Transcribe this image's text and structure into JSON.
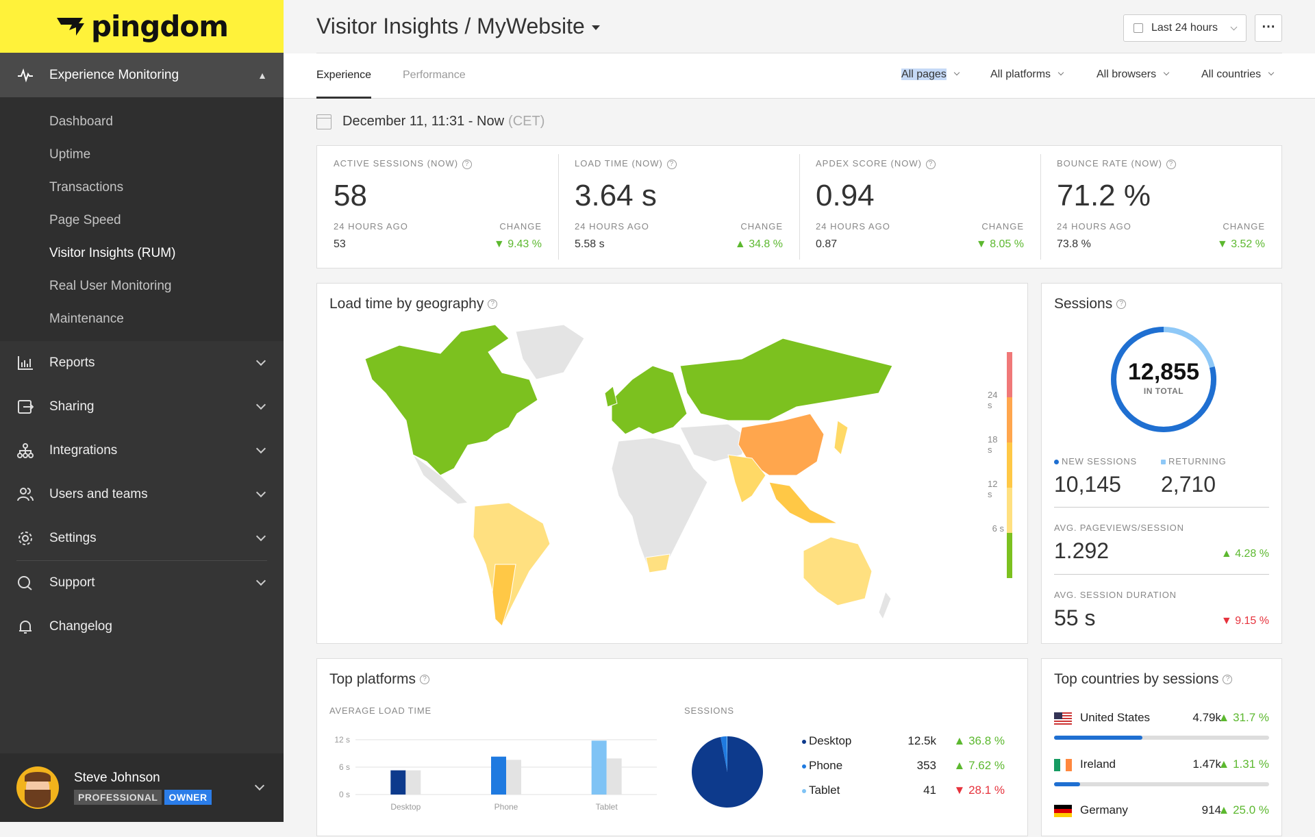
{
  "brand": {
    "name": "pingdom",
    "color": "#fff23a"
  },
  "sidebar": {
    "section": {
      "label": "Experience Monitoring"
    },
    "subitems": [
      {
        "label": "Dashboard"
      },
      {
        "label": "Uptime"
      },
      {
        "label": "Transactions"
      },
      {
        "label": "Page Speed"
      },
      {
        "label": "Visitor Insights (RUM)",
        "active": true
      },
      {
        "label": "Real User Monitoring"
      },
      {
        "label": "Maintenance"
      }
    ],
    "items": [
      {
        "label": "Reports",
        "icon": "chart-icon"
      },
      {
        "label": "Sharing",
        "icon": "share-icon"
      },
      {
        "label": "Integrations",
        "icon": "network-icon"
      },
      {
        "label": "Users and teams",
        "icon": "users-icon"
      },
      {
        "label": "Settings",
        "icon": "gear-icon"
      },
      {
        "label": "Support",
        "icon": "chat-icon"
      },
      {
        "label": "Changelog",
        "icon": "bell-icon"
      }
    ],
    "user": {
      "name": "Steve Johnson",
      "plan": "PROFESSIONAL",
      "role": "OWNER"
    }
  },
  "header": {
    "title": "Visitor Insights / MyWebsite",
    "time_range": "Last 24 hours",
    "more": "⋯"
  },
  "tabs": [
    {
      "label": "Experience",
      "active": true
    },
    {
      "label": "Performance"
    }
  ],
  "filters": [
    {
      "label": "All pages",
      "selected": true
    },
    {
      "label": "All platforms"
    },
    {
      "label": "All browsers"
    },
    {
      "label": "All countries"
    }
  ],
  "date_range": {
    "text": "December 11, 11:31 - Now",
    "tz": "(CET)"
  },
  "kpis": [
    {
      "label": "ACTIVE SESSIONS (NOW)",
      "value": "58",
      "prev_label": "24 HOURS AGO",
      "prev": "53",
      "change_label": "CHANGE",
      "change": "▼ 9.43 %",
      "trend": "up"
    },
    {
      "label": "LOAD TIME (NOW)",
      "value": "3.64 s",
      "prev_label": "24 HOURS AGO",
      "prev": "5.58 s",
      "change_label": "CHANGE",
      "change": "▲ 34.8 %",
      "trend": "up"
    },
    {
      "label": "APDEX SCORE (NOW)",
      "value": "0.94",
      "prev_label": "24 HOURS AGO",
      "prev": "0.87",
      "change_label": "CHANGE",
      "change": "▼ 8.05 %",
      "trend": "up"
    },
    {
      "label": "BOUNCE RATE (NOW)",
      "value": "71.2 %",
      "prev_label": "24 HOURS AGO",
      "prev": "73.8 %",
      "change_label": "CHANGE",
      "change": "▼ 3.52 %",
      "trend": "up"
    }
  ],
  "map_card": {
    "title": "Load time by geography",
    "legend": [
      "24 s",
      "18 s",
      "12 s",
      "6 s"
    ],
    "colors": {
      "fast": "#7cc11f",
      "mid": "#ffd966",
      "slow": "#ffa64d",
      "none": "#e4e4e4"
    }
  },
  "sessions_card": {
    "title": "Sessions",
    "total": "12,855",
    "total_label": "IN TOTAL",
    "new_label": "NEW SESSIONS",
    "new": "10,145",
    "returning_label": "RETURNING",
    "returning": "2,710",
    "pv_label": "AVG. PAGEVIEWS/SESSION",
    "pv": "1.292",
    "pv_change": "▲ 4.28 %",
    "dur_label": "AVG. SESSION DURATION",
    "dur": "55 s",
    "dur_change": "▼ 9.15 %"
  },
  "platforms_card": {
    "title": "Top platforms",
    "load_label": "AVERAGE LOAD TIME",
    "sessions_label": "SESSIONS",
    "rows": [
      {
        "name": "Desktop",
        "sessions": "12.5k",
        "change": "▲ 36.8 %",
        "trend": "up",
        "color": "#0d3a8c"
      },
      {
        "name": "Phone",
        "sessions": "353",
        "change": "▲ 7.62 %",
        "trend": "up",
        "color": "#1f7ae0"
      },
      {
        "name": "Tablet",
        "sessions": "41",
        "change": "▼ 28.1 %",
        "trend": "down",
        "color": "#7fc3f5"
      }
    ]
  },
  "countries_card": {
    "title": "Top countries by sessions",
    "rows": [
      {
        "name": "United States",
        "value": "4.79k",
        "change": "▲ 31.7 %",
        "share": 0.41
      },
      {
        "name": "Ireland",
        "value": "1.47k",
        "change": "▲ 1.31 %",
        "share": 0.12
      },
      {
        "name": "Germany",
        "value": "914",
        "change": "▲ 25.0 %",
        "share": 0.08
      }
    ]
  },
  "chart_data": [
    {
      "type": "bar",
      "title": "AVERAGE LOAD TIME",
      "categories": [
        "Desktop",
        "Phone",
        "Tablet"
      ],
      "ylim": [
        0,
        12
      ],
      "yticks": [
        "12 s",
        "6 s",
        "0 s"
      ],
      "series": [
        {
          "values": [
            5.3,
            8.3,
            11.8
          ]
        },
        {
          "values": [
            5.3,
            7.6,
            7.9
          ]
        }
      ]
    },
    {
      "type": "pie",
      "title": "SESSIONS",
      "categories": [
        "Desktop",
        "Phone",
        "Tablet"
      ],
      "values": [
        12500,
        353,
        41
      ]
    }
  ]
}
